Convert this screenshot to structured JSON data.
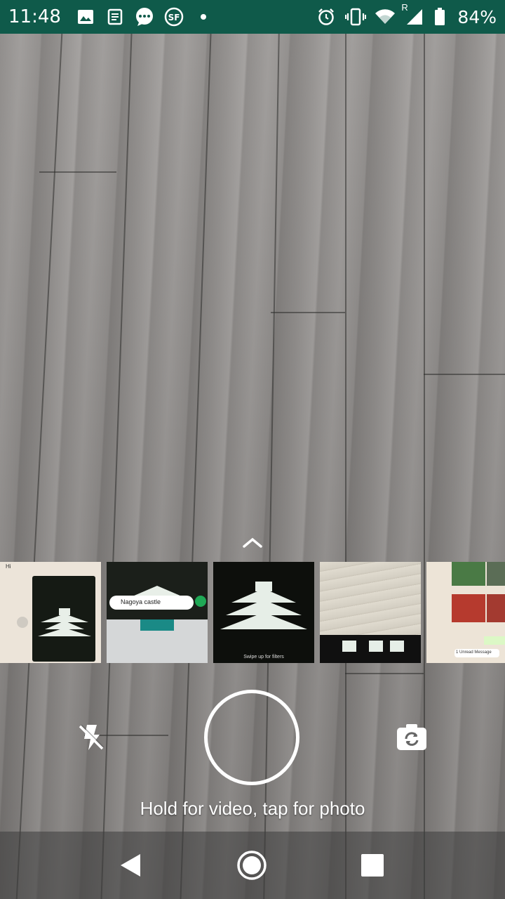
{
  "status_bar": {
    "time": "11:48",
    "battery": "84%",
    "left_icons": [
      "image-icon",
      "news-icon",
      "message-icon",
      "sf-app-icon",
      "dot-icon"
    ],
    "right_icons": [
      "alarm-icon",
      "vibrate-icon",
      "wifi-icon",
      "signal-roaming-icon",
      "battery-icon"
    ],
    "roaming_label": "R"
  },
  "gallery": {
    "thumbnails": [
      {
        "name": "chat-screenshot-castle",
        "caption": "Hi"
      },
      {
        "name": "chat-keyboard-screenshot",
        "caption": "Nagoya castle"
      },
      {
        "name": "castle-photo-filter",
        "caption": "Swipe up for filters"
      },
      {
        "name": "floor-camera-screenshot",
        "caption": ""
      },
      {
        "name": "chat-photos-screenshot",
        "caption": "1 Unread Message"
      }
    ]
  },
  "controls": {
    "hint": "Hold for video, tap for photo",
    "flash_icon": "flash-off-icon",
    "flip_icon": "camera-flip-icon"
  },
  "colors": {
    "status_bar": "#0f5a4a",
    "accent": "#ffffff"
  }
}
